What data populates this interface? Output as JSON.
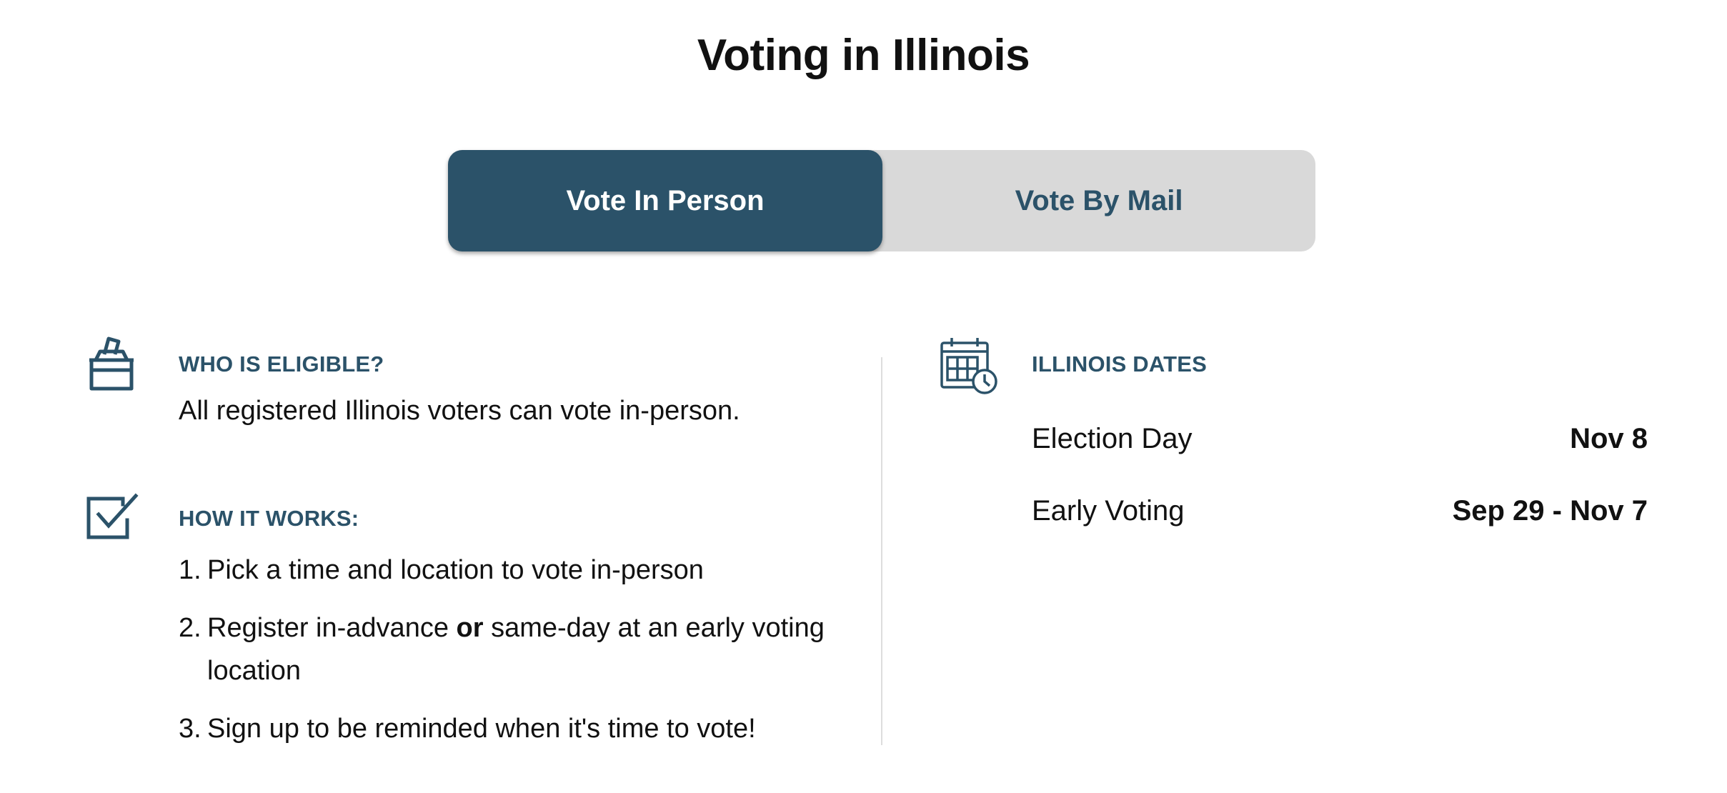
{
  "page": {
    "title": "Voting in Illinois"
  },
  "toggle": {
    "options": [
      {
        "label": "Vote In Person",
        "selected": true
      },
      {
        "label": "Vote By Mail",
        "selected": false
      }
    ]
  },
  "eligibility": {
    "heading": "WHO IS ELIGIBLE?",
    "text": "All registered Illinois voters can vote in-person."
  },
  "how_it_works": {
    "heading": "HOW IT WORKS:",
    "steps": [
      {
        "num": "1.",
        "parts": [
          "Pick a time and location to vote in-person"
        ]
      },
      {
        "num": "2.",
        "parts": [
          "Register in-advance ",
          "or",
          " same-day at an early voting location"
        ]
      },
      {
        "num": "3.",
        "parts": [
          "Sign up to be reminded when it's time to vote!"
        ]
      }
    ]
  },
  "dates": {
    "heading": "ILLINOIS DATES",
    "rows": [
      {
        "label": "Election Day",
        "value": "Nov 8"
      },
      {
        "label": "Early Voting",
        "value": "Sep 29 - Nov 7"
      }
    ]
  },
  "icons": {
    "ballot_box": "ballot-box-icon",
    "checkbox": "checkbox-check-icon",
    "calendar": "calendar-clock-icon"
  },
  "colors": {
    "brand": "#2b5269",
    "toggle_background": "#d9d9d9",
    "divider": "#dddddd"
  }
}
